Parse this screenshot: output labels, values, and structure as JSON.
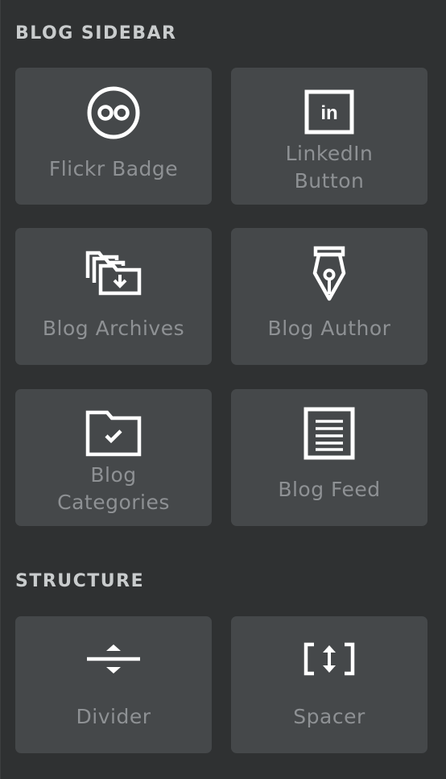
{
  "sections": {
    "blog_sidebar": {
      "title": "BLOG SIDEBAR",
      "tiles": [
        {
          "label": "Flickr Badge",
          "icon": "flickr-icon"
        },
        {
          "label_line1": "LinkedIn",
          "label_line2": "Button",
          "icon": "linkedin-icon"
        },
        {
          "label": "Blog Archives",
          "icon": "folder-download-icon"
        },
        {
          "label": "Blog Author",
          "icon": "pen-nib-icon"
        },
        {
          "label_line1": "Blog",
          "label_line2": "Categories",
          "icon": "folder-check-icon"
        },
        {
          "label": "Blog Feed",
          "icon": "document-lines-icon"
        }
      ]
    },
    "structure": {
      "title": "STRUCTURE",
      "tiles": [
        {
          "label": "Divider",
          "icon": "divider-icon"
        },
        {
          "label": "Spacer",
          "icon": "spacer-icon"
        }
      ]
    }
  },
  "colors": {
    "background": "#2f3132",
    "tile": "#45484a",
    "icon": "#ffffff",
    "label": "#8e9194",
    "section_title": "#c9cccd"
  }
}
